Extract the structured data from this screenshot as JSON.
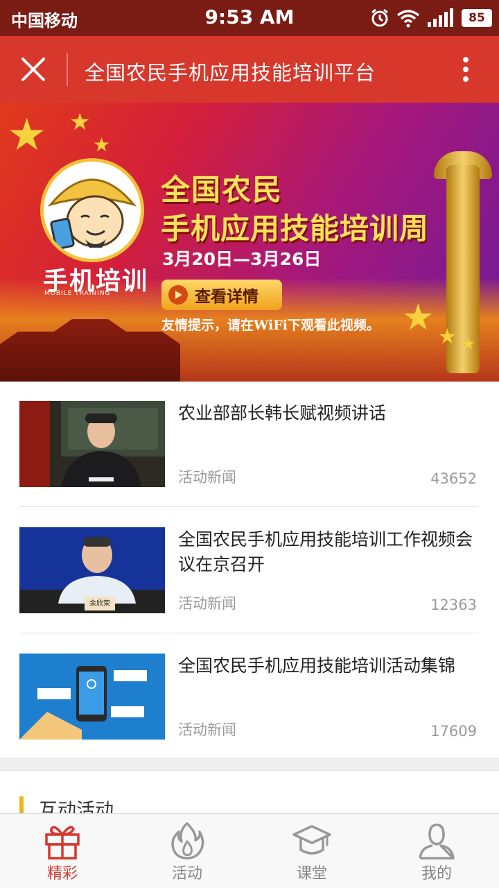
{
  "status_bar": {
    "carrier": "中国移动",
    "time": "9:53 AM",
    "battery": "85"
  },
  "title_bar": {
    "title": "全国农民手机应用技能培训平台"
  },
  "banner": {
    "logo_title": "手机培训",
    "logo_subtitle": "MOBILE TRAINING",
    "headline_line1": "全国农民",
    "headline_line2": "手机应用技能培训周",
    "date_range": "3月20日—3月26日",
    "button_label": "查看详情",
    "tip": "友情提示，请在WiFi下观看此视频。"
  },
  "news": [
    {
      "title": "农业部部长韩长赋视频讲话",
      "category": "活动新闻",
      "views": "43652"
    },
    {
      "title": "全国农民手机应用技能培训工作视频会议在京召开",
      "category": "活动新闻",
      "views": "12363"
    },
    {
      "title": "全国农民手机应用技能培训活动集锦",
      "category": "活动新闻",
      "views": "17609"
    }
  ],
  "thumbs": {
    "nameplate": "余欣荣"
  },
  "section": {
    "title": "互动活动"
  },
  "tabs": [
    {
      "label": "精彩",
      "icon": "gift-icon",
      "active": true
    },
    {
      "label": "活动",
      "icon": "flame-icon",
      "active": false
    },
    {
      "label": "课堂",
      "icon": "graduation-cap-icon",
      "active": false
    },
    {
      "label": "我的",
      "icon": "user-icon",
      "active": false
    }
  ],
  "colors": {
    "status_bar": "#7a1b14",
    "title_bar": "#d8372c",
    "accent": "#d8372c",
    "section_bar": "#f0b316"
  }
}
